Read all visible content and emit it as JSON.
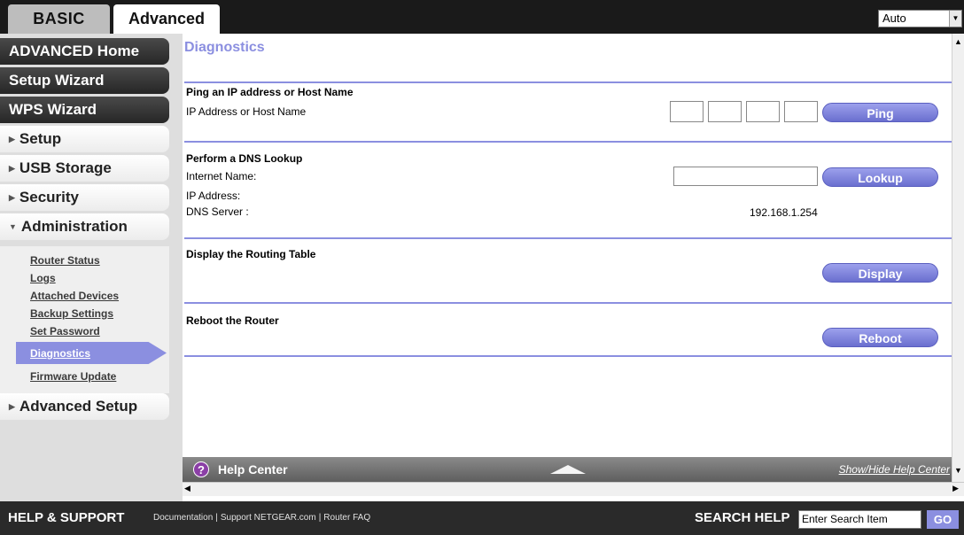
{
  "tabs": {
    "basic": "BASIC",
    "advanced": "Advanced"
  },
  "language": {
    "selected": "Auto"
  },
  "nav": {
    "advanced_home": "ADVANCED Home",
    "setup_wizard": "Setup Wizard",
    "wps_wizard": "WPS Wizard",
    "setup": "Setup",
    "usb_storage": "USB Storage",
    "security": "Security",
    "administration": "Administration",
    "advanced_setup": "Advanced Setup",
    "admin_items": [
      "Router Status",
      "Logs",
      "Attached Devices",
      "Backup Settings",
      "Set Password",
      "Diagnostics",
      "Firmware Update"
    ]
  },
  "main": {
    "title": "Diagnostics",
    "ping": {
      "section_title": "Ping an IP address or Host Name",
      "label": "IP Address or Host Name",
      "button": "Ping"
    },
    "dns": {
      "section_title": "Perform a DNS Lookup",
      "internet_name_label": "Internet Name:",
      "button": "Lookup",
      "ip_label": "IP Address:",
      "server_label": "DNS Server :",
      "server_value": "192.168.1.254"
    },
    "routing": {
      "section_title": "Display the Routing Table",
      "button": "Display"
    },
    "reboot": {
      "section_title": "Reboot the Router",
      "button": "Reboot"
    }
  },
  "help_center": {
    "title": "Help Center",
    "toggle": "Show/Hide Help Center"
  },
  "footer": {
    "help_support": "HELP & SUPPORT",
    "links": [
      "Documentation",
      "Support NETGEAR.com",
      "Router FAQ"
    ],
    "search_label": "SEARCH HELP",
    "search_placeholder": "Enter Search Item",
    "go": "GO"
  },
  "colors": {
    "accent": "#8b8fe0",
    "dark": "#1a1a1a"
  }
}
